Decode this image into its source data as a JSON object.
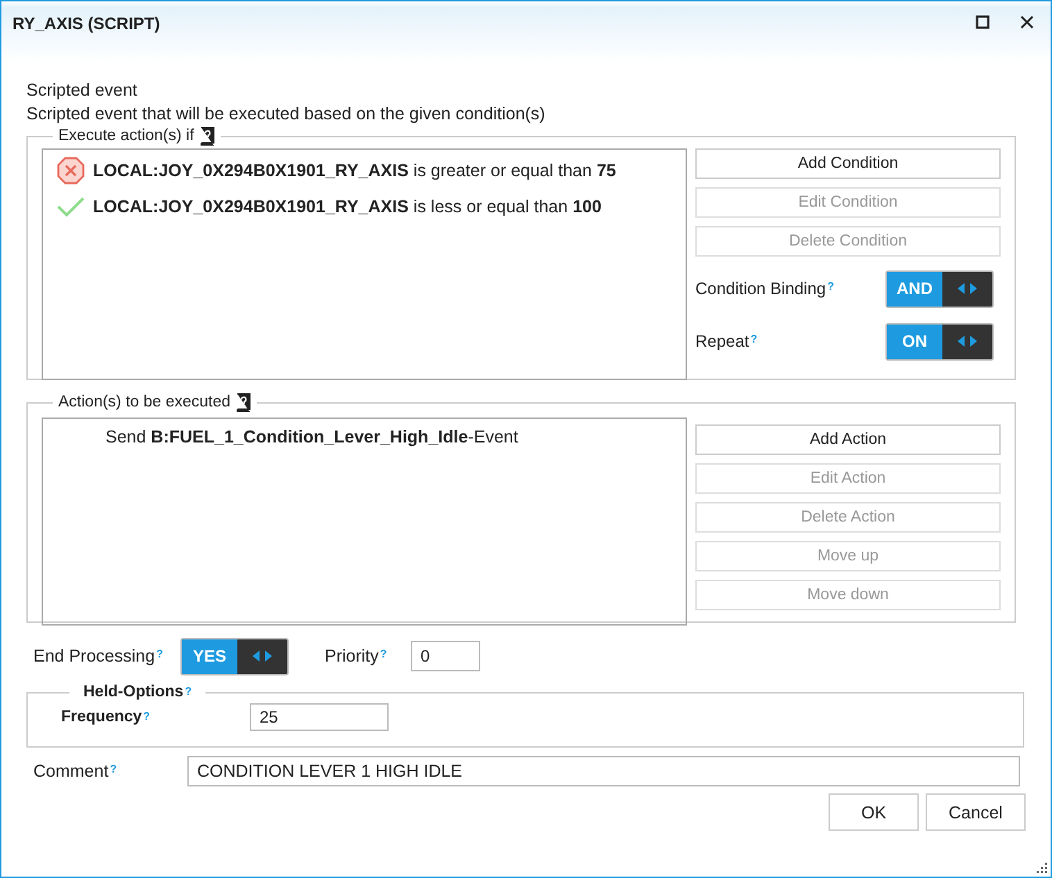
{
  "window": {
    "title": "RY_AXIS (SCRIPT)"
  },
  "header": {
    "title": "Scripted event",
    "description": "Scripted event that will be executed based on the given condition(s)"
  },
  "conditions_group": {
    "legend": "Execute action(s) if",
    "items": [
      {
        "kind": "error",
        "text": "**LOCAL:JOY_0X294B0X1901_RY_AXIS** is greater or equal than **75**"
      },
      {
        "kind": "ok",
        "text": "**LOCAL:JOY_0X294B0X1901_RY_AXIS** is less or equal than **100**"
      }
    ],
    "buttons": [
      {
        "label": "Add Condition",
        "disabled": false
      },
      {
        "label": "Edit Condition",
        "disabled": true
      },
      {
        "label": "Delete Condition",
        "disabled": true
      }
    ],
    "toggles": [
      {
        "label": "Condition Binding",
        "help": "?",
        "value": "AND",
        "on": true
      },
      {
        "label": "Repeat",
        "help": "?",
        "value": "ON",
        "on": true
      }
    ]
  },
  "actions_group": {
    "legend": "Action(s) to be executed",
    "items": [
      {
        "text": "Send **B:FUEL_1_Condition_Lever_High_Idle**-Event"
      }
    ],
    "buttons": [
      {
        "label": "Add Action",
        "disabled": false
      },
      {
        "label": "Edit Action",
        "disabled": true
      },
      {
        "label": "Delete Action",
        "disabled": true
      },
      {
        "label": "Move up",
        "disabled": true
      },
      {
        "label": "Move down",
        "disabled": true
      }
    ]
  },
  "end_processing": {
    "label": "End Processing",
    "help": "?",
    "value": "YES",
    "on": true
  },
  "priority": {
    "label": "Priority",
    "help": "?",
    "value": "0"
  },
  "held_options": {
    "legend": "Held-Options",
    "help": "?",
    "frequency": {
      "label": "Frequency",
      "help": "?",
      "value": "25"
    }
  },
  "comment": {
    "label": "Comment",
    "help": "?",
    "value": "CONDITION LEVER 1 HIGH IDLE"
  },
  "buttons": [
    "OK",
    "Cancel"
  ]
}
